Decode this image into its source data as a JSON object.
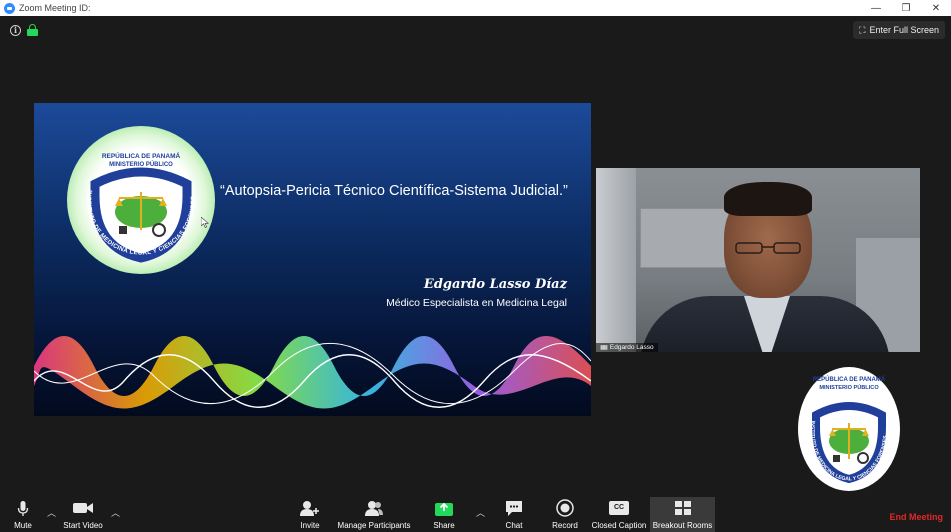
{
  "window": {
    "title": "Zoom Meeting ID:",
    "controls": [
      "—",
      "❐",
      "✕"
    ]
  },
  "header": {
    "full_screen_label": "Enter Full Screen"
  },
  "slide": {
    "title": "“Autopsia-Pericia Técnico Científica-Sistema Judicial.”",
    "author": "Edgardo Lasso Díaz",
    "subtitle": "Médico Especialista en Medicina Legal"
  },
  "logo": {
    "top_text_1": "REPÚBLICA DE PANAMÁ",
    "top_text_2": "MINISTERIO PÚBLICO",
    "ring_text": "INSTITUTO DE MEDICINA LEGAL Y CIENCIAS FORENSES",
    "colors": {
      "ring": "#1f3f9a",
      "inner": "#ffffff",
      "map": "#4caf3c",
      "scale": "#e0b020"
    }
  },
  "participant": {
    "name": "Edgardo Lasso"
  },
  "toolbar": {
    "mute": "Mute",
    "start_video": "Start Video",
    "invite": "Invite",
    "manage_participants": "Manage Participants",
    "share": "Share",
    "chat": "Chat",
    "record": "Record",
    "closed_caption": "Closed Caption",
    "closed_caption_icon": "CC",
    "breakout_rooms": "Breakout Rooms",
    "end_meeting": "End Meeting"
  },
  "colors": {
    "accent_green": "#23d959",
    "end_red": "#e02828",
    "background": "#1a1a1a"
  }
}
